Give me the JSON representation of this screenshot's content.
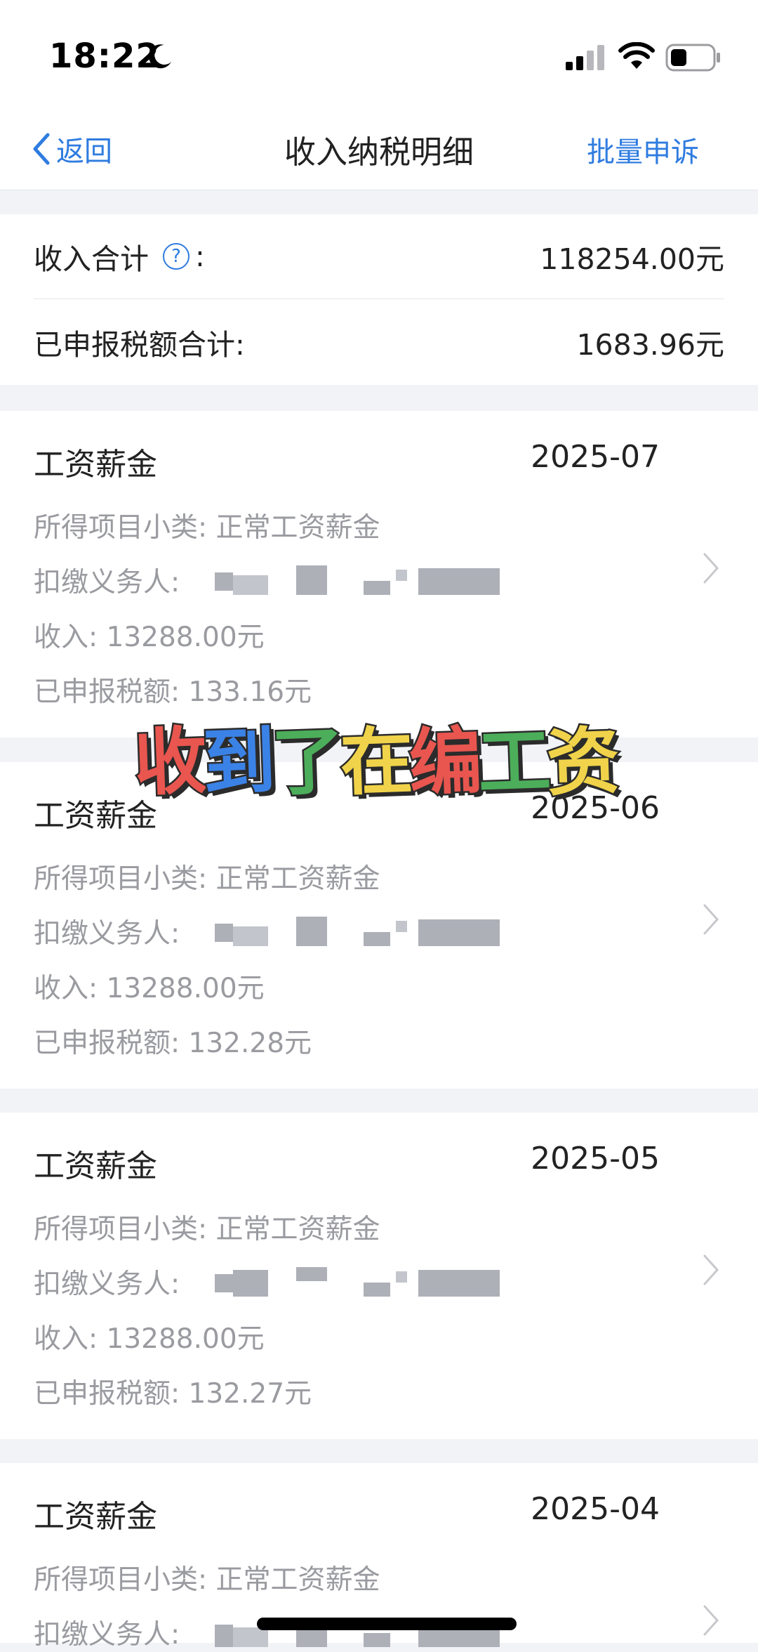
{
  "status_bar": {
    "time": "18:22"
  },
  "nav": {
    "back_label": "返回",
    "title": "收入纳税明细",
    "action_label": "批量申诉"
  },
  "summary": {
    "income_label": "收入合计",
    "income_colon": ":",
    "income_value": "118254.00元",
    "tax_label": "已申报税额合计:",
    "tax_value": "1683.96元",
    "help_glyph": "?"
  },
  "records": [
    {
      "title": "工资薪金",
      "date": "2025-07",
      "subcat_label": "所得项目小类:",
      "subcat_value": "正常工资薪金",
      "payer_label": "扣缴义务人:",
      "income_label": "收入:",
      "income_value": "13288.00元",
      "tax_label": "已申报税额:",
      "tax_value": "133.16元"
    },
    {
      "title": "工资薪金",
      "date": "2025-06",
      "subcat_label": "所得项目小类:",
      "subcat_value": "正常工资薪金",
      "payer_label": "扣缴义务人:",
      "income_label": "收入:",
      "income_value": "13288.00元",
      "tax_label": "已申报税额:",
      "tax_value": "132.28元"
    },
    {
      "title": "工资薪金",
      "date": "2025-05",
      "subcat_label": "所得项目小类:",
      "subcat_value": "正常工资薪金",
      "payer_label": "扣缴义务人:",
      "income_label": "收入:",
      "income_value": "13288.00元",
      "tax_label": "已申报税额:",
      "tax_value": "132.27元"
    },
    {
      "title": "工资薪金",
      "date": "2025-04",
      "subcat_label": "所得项目小类:",
      "subcat_value": "正常工资薪金",
      "payer_label": "扣缴义务人:"
    }
  ],
  "sticker": {
    "chars": [
      "收",
      "到",
      "了",
      "在",
      "编",
      "工",
      "资"
    ],
    "colors": [
      "#e8564f",
      "#3b82e6",
      "#4cae5a",
      "#f0d34a",
      "#e8564f",
      "#4cae5a",
      "#f0d34a"
    ]
  },
  "colors": {
    "accent": "#2f7ce0",
    "secondary_text": "#9a9ba0",
    "background": "#f2f3f7"
  }
}
